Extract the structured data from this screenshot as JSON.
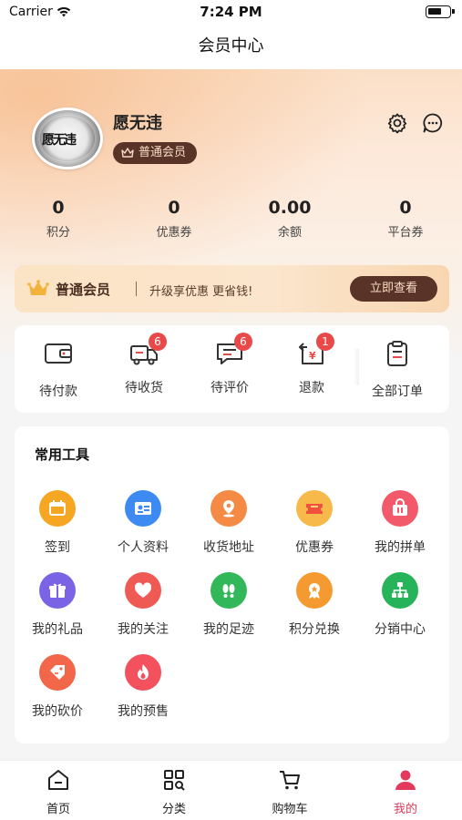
{
  "status_bar": {
    "carrier": "Carrier",
    "time": "7:24 PM"
  },
  "nav": {
    "title": "会员中心"
  },
  "profile": {
    "username": "愿无违",
    "member_level": "普通会员",
    "avatar_text": "愿无违"
  },
  "stats": [
    {
      "value": "0",
      "label": "积分"
    },
    {
      "value": "0",
      "label": "优惠券"
    },
    {
      "value": "0.00",
      "label": "余额"
    },
    {
      "value": "0",
      "label": "平台券"
    }
  ],
  "upgrade": {
    "title": "普通会员",
    "text": "升级享优惠 更省钱!",
    "button": "立即查看"
  },
  "orders": [
    {
      "label": "待付款",
      "icon": "wallet-icon",
      "badge": ""
    },
    {
      "label": "待收货",
      "icon": "delivery-truck-icon",
      "badge": "6"
    },
    {
      "label": "待评价",
      "icon": "comment-icon",
      "badge": "6"
    },
    {
      "label": "退款",
      "icon": "refund-icon",
      "badge": "1"
    },
    {
      "label": "全部订单",
      "icon": "clipboard-icon",
      "badge": ""
    }
  ],
  "tools": {
    "title": "常用工具",
    "items": [
      {
        "label": "签到",
        "icon": "calendar-icon",
        "color": "#f5a623"
      },
      {
        "label": "个人资料",
        "icon": "id-card-icon",
        "color": "#3d8bf2"
      },
      {
        "label": "收货地址",
        "icon": "location-pin-icon",
        "color": "#f58a45"
      },
      {
        "label": "优惠券",
        "icon": "coupon-icon",
        "color": "#f7b94a"
      },
      {
        "label": "我的拼单",
        "icon": "basket-icon",
        "color": "#f25a6b"
      },
      {
        "label": "我的礼品",
        "icon": "gift-icon",
        "color": "#7b63e6"
      },
      {
        "label": "我的关注",
        "icon": "heart-icon",
        "color": "#f05a55"
      },
      {
        "label": "我的足迹",
        "icon": "footprint-icon",
        "color": "#32b85a"
      },
      {
        "label": "积分兑换",
        "icon": "medal-icon",
        "color": "#f59a30"
      },
      {
        "label": "分销中心",
        "icon": "network-icon",
        "color": "#27b35a"
      },
      {
        "label": "我的砍价",
        "icon": "price-tag-icon",
        "color": "#f2664a"
      },
      {
        "label": "我的预售",
        "icon": "flame-icon",
        "color": "#f2515d"
      }
    ]
  },
  "tabbar": [
    {
      "label": "首页",
      "icon": "home-icon"
    },
    {
      "label": "分类",
      "icon": "category-icon"
    },
    {
      "label": "购物车",
      "icon": "cart-icon"
    },
    {
      "label": "我的",
      "icon": "user-icon"
    }
  ],
  "colors": {
    "accent": "#e23a5c",
    "badge": "#e84a4a",
    "brown": "#5a3328"
  }
}
